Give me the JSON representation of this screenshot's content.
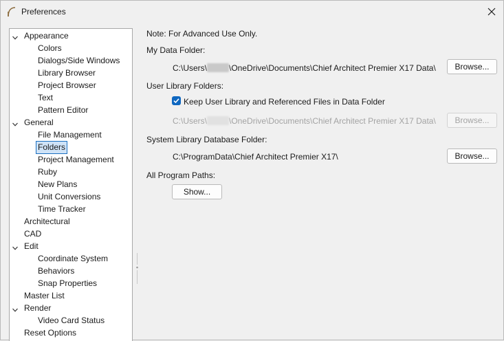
{
  "window": {
    "title": "Preferences"
  },
  "tree": [
    {
      "label": "Appearance",
      "level": 0,
      "expanded": true
    },
    {
      "label": "Colors",
      "level": 1
    },
    {
      "label": "Dialogs/Side Windows",
      "level": 1
    },
    {
      "label": "Library Browser",
      "level": 1
    },
    {
      "label": "Project Browser",
      "level": 1
    },
    {
      "label": "Text",
      "level": 1
    },
    {
      "label": "Pattern Editor",
      "level": 1
    },
    {
      "label": "General",
      "level": 0,
      "expanded": true
    },
    {
      "label": "File Management",
      "level": 1
    },
    {
      "label": "Folders",
      "level": 1,
      "selected": true
    },
    {
      "label": "Project Management",
      "level": 1
    },
    {
      "label": "Ruby",
      "level": 1
    },
    {
      "label": "New Plans",
      "level": 1
    },
    {
      "label": "Unit Conversions",
      "level": 1
    },
    {
      "label": "Time Tracker",
      "level": 1
    },
    {
      "label": "Architectural",
      "level": 0
    },
    {
      "label": "CAD",
      "level": 0
    },
    {
      "label": "Edit",
      "level": 0,
      "expanded": true
    },
    {
      "label": "Coordinate System",
      "level": 1
    },
    {
      "label": "Behaviors",
      "level": 1
    },
    {
      "label": "Snap Properties",
      "level": 1
    },
    {
      "label": "Master List",
      "level": 0
    },
    {
      "label": "Render",
      "level": 0,
      "expanded": true
    },
    {
      "label": "Video Card Status",
      "level": 1
    },
    {
      "label": "Reset Options",
      "level": 0
    }
  ],
  "folders": {
    "note": "Note: For Advanced Use Only.",
    "my_data_label": "My Data Folder:",
    "my_data_path_prefix": "C:\\Users\\",
    "my_data_path_suffix": "\\OneDrive\\Documents\\Chief Architect Premier X17 Data\\",
    "browse_label": "Browse...",
    "user_library_label": "User Library Folders:",
    "keep_checkbox_label": "Keep User Library and Referenced Files in Data Folder",
    "keep_checked": true,
    "user_lib_path_prefix": "C:\\Users\\",
    "user_lib_path_suffix": "\\OneDrive\\Documents\\Chief Architect Premier X17 Data\\",
    "system_lib_label": "System Library Database Folder:",
    "system_lib_path": "C:\\ProgramData\\Chief Architect Premier X17\\",
    "all_paths_label": "All Program Paths:",
    "show_label": "Show..."
  },
  "colors": {
    "accent": "#0f67c0",
    "selection_bg": "#cfe3f7"
  }
}
